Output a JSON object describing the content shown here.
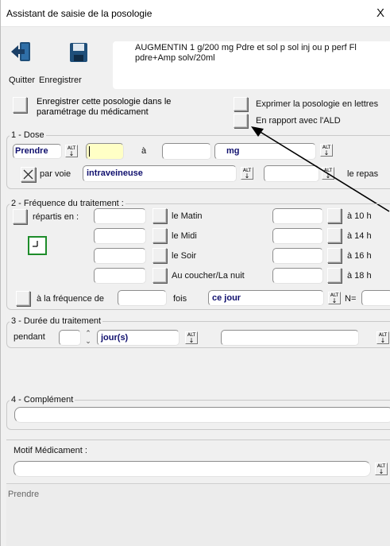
{
  "window": {
    "title": "Assistant de saisie de la posologie",
    "close_glyph": "X"
  },
  "toolbar": {
    "quit_label": "Quitter",
    "save_label": "Enregistrer",
    "quit_icon": "exit-door-arrow-icon",
    "save_icon": "floppy-disk-icon"
  },
  "medication": {
    "name": "AUGMENTIN 1 g/200 mg Pdre et sol p sol inj ou p perf Fl pdre+Amp solv/20ml"
  },
  "options": {
    "save_dosage": "Enregistrer cette posologie dans le paramétrage du médicament",
    "express_letters": "Exprimer la posologie en lettres",
    "ald": "En rapport avec l'ALD"
  },
  "dose": {
    "section_title": "1 - Dose",
    "verb": "Prendre",
    "alt_label": "ALT",
    "from_value": "",
    "to_label": "à",
    "to_value": "",
    "unit": "mg",
    "route_label": "par voie",
    "route_value": "intraveineuse",
    "meal_value": "",
    "meal_label": "le repas"
  },
  "frequency": {
    "section_title": "2 - Fréquence du traitement :",
    "spread_label": "répartis en :",
    "clock_icon": "clock-icon",
    "moments": [
      {
        "label": "le Matin",
        "hour": "à 10 h"
      },
      {
        "label": "le Midi",
        "hour": "à 14 h"
      },
      {
        "label": "le Soir",
        "hour": "à 16 h"
      },
      {
        "label": "Au coucher/La nuit",
        "hour": "à 18 h"
      }
    ],
    "freq_label": "à la fréquence de",
    "times_label": "fois",
    "period_value": "ce jour",
    "n_label": "N="
  },
  "duration": {
    "section_title": "3 - Durée du traitement",
    "during_label": "pendant",
    "count_value": "",
    "unit_value": "jour(s)"
  },
  "complement": {
    "section_title": "4 - Complément",
    "value": ""
  },
  "motif": {
    "label": "Motif Médicament :",
    "value": ""
  },
  "preview": {
    "text": "Prendre"
  },
  "colors": {
    "window_bg": "#f0f0f0",
    "combo_text": "#10106e",
    "dose_highlight": "#ffffc6",
    "clock_green": "#1e8c2a"
  }
}
